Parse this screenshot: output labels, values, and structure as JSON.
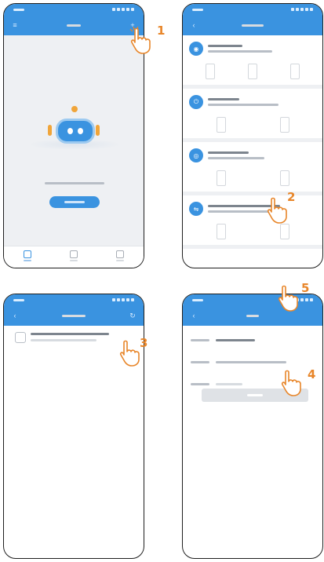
{
  "accent_color": "#3a93e0",
  "step_color": "#e8862a",
  "hand_icon": "pointing-hand-icon",
  "steps": [
    "1",
    "2",
    "3",
    "4",
    "5"
  ]
}
